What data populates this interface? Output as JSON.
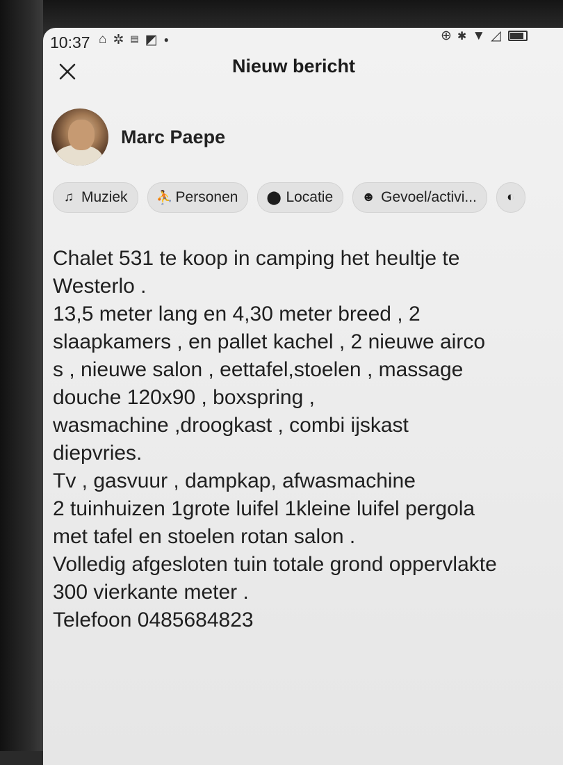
{
  "status_bar": {
    "time": "10:37",
    "left_icons": [
      "home-outline-icon",
      "settings-gear-icon",
      "wifi-calling-icon",
      "image-icon",
      "notification-dot-icon"
    ],
    "right_icons": [
      "data-saver-icon",
      "bluetooth-icon",
      "wifi-icon",
      "signal-icon",
      "battery-icon"
    ]
  },
  "header": {
    "title": "Nieuw bericht",
    "close_icon": "close-icon"
  },
  "user": {
    "name": "Marc Paepe"
  },
  "chips": [
    {
      "label": "Muziek",
      "icon": "music-note-icon"
    },
    {
      "label": "Personen",
      "icon": "person-tag-icon"
    },
    {
      "label": "Locatie",
      "icon": "location-pin-icon"
    },
    {
      "label": "Gevoel/activi...",
      "icon": "smiley-icon"
    }
  ],
  "post": {
    "lines": [
      "Chalet 531 te koop in camping het heultje te",
      "Westerlo .",
      "13,5 meter lang en 4,30 meter breed , 2",
      "slaapkamers , en pallet kachel , 2 nieuwe airco",
      "s , nieuwe salon , eettafel,stoelen , massage",
      "douche 120x90 , boxspring ,",
      "wasmachine ,droogkast , combi ijskast",
      "diepvries.",
      "Tv , gasvuur , dampkap, afwasmachine",
      "2 tuinhuizen 1grote luifel 1kleine luifel pergola",
      "met tafel en stoelen rotan salon .",
      "Volledig afgesloten tuin totale grond oppervlakte",
      "300 vierkante meter .",
      "Telefoon 0485684823"
    ]
  },
  "battery_level": 0.85
}
